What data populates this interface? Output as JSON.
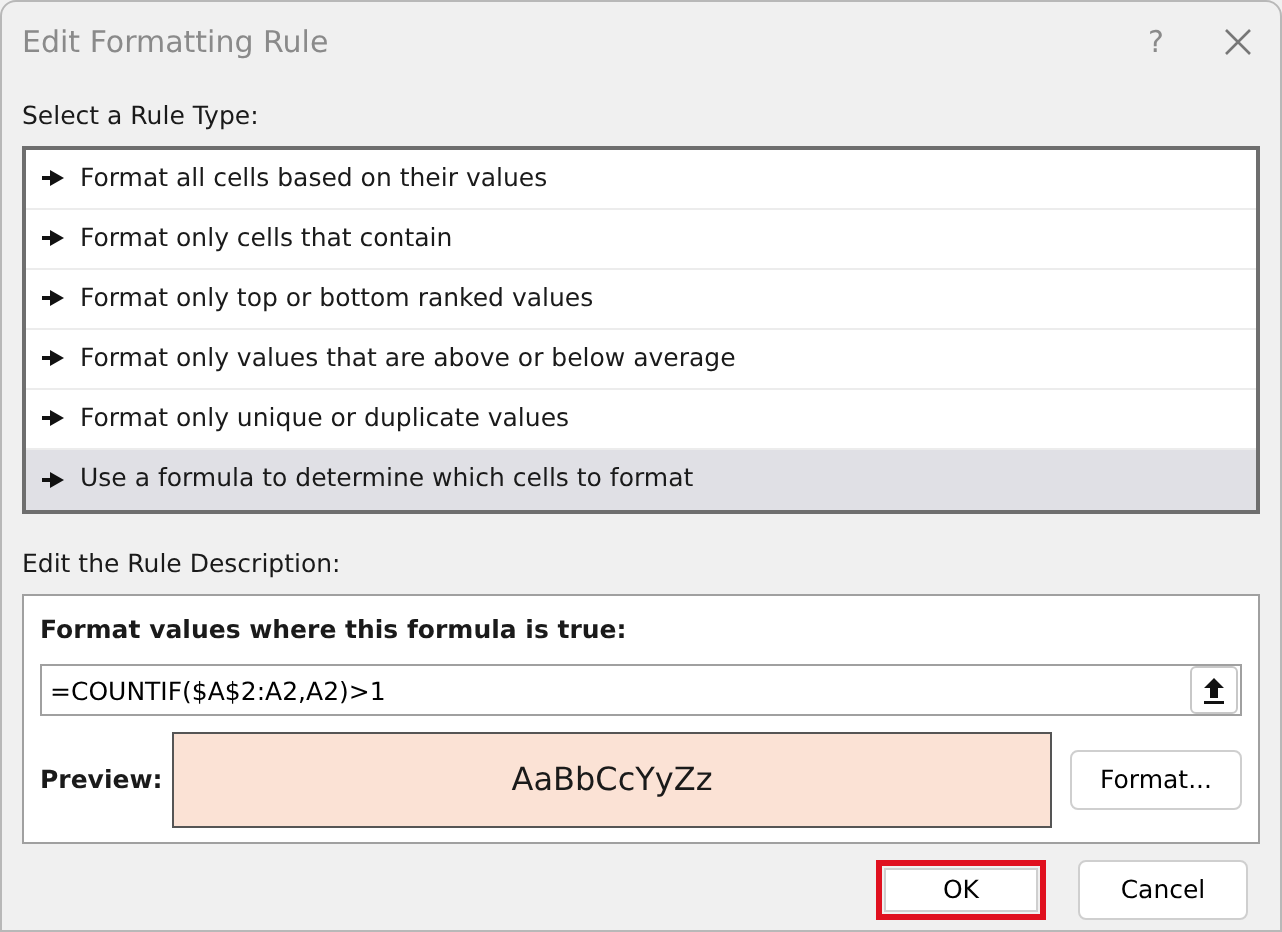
{
  "window": {
    "title": "Edit Formatting Rule",
    "help": "?"
  },
  "rule_type": {
    "label": "Select a Rule Type:",
    "items": [
      {
        "label": "Format all cells based on their values",
        "selected": false
      },
      {
        "label": "Format only cells that contain",
        "selected": false
      },
      {
        "label": "Format only top or bottom ranked values",
        "selected": false
      },
      {
        "label": "Format only values that are above or below average",
        "selected": false
      },
      {
        "label": "Format only unique or duplicate values",
        "selected": false
      },
      {
        "label": "Use a formula to determine which cells to format",
        "selected": true
      }
    ]
  },
  "description": {
    "label": "Edit the Rule Description:",
    "heading": "Format values where this formula is true:",
    "formula": "=COUNTIF($A$2:A2,A2)>1",
    "preview_label": "Preview:",
    "preview_text": "AaBbCcYyZz",
    "format_button": "Format..."
  },
  "buttons": [
    {
      "label": "OK",
      "highlighted": true
    },
    {
      "label": "Cancel",
      "highlighted": false
    }
  ]
}
